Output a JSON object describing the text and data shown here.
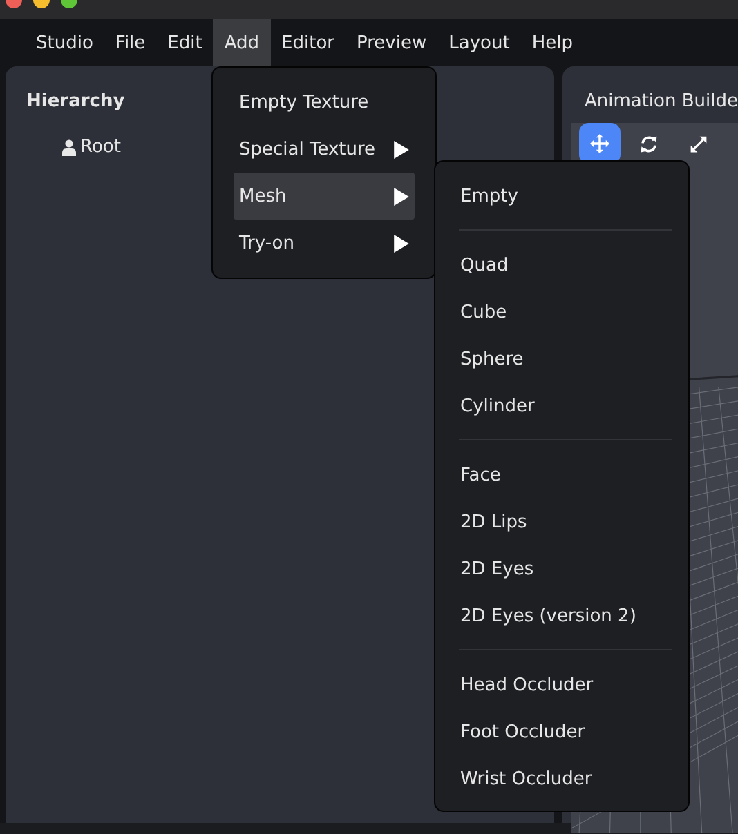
{
  "menubar": [
    {
      "label": "Studio",
      "selected": false
    },
    {
      "label": "File",
      "selected": false
    },
    {
      "label": "Edit",
      "selected": false
    },
    {
      "label": "Add",
      "selected": true
    },
    {
      "label": "Editor",
      "selected": false
    },
    {
      "label": "Preview",
      "selected": false
    },
    {
      "label": "Layout",
      "selected": false
    },
    {
      "label": "Help",
      "selected": false
    }
  ],
  "hierarchy": {
    "title": "Hierarchy",
    "items": [
      {
        "label": "Root"
      }
    ]
  },
  "animation_builder": {
    "title": "Animation Builde",
    "tools": [
      {
        "kind": "move",
        "selected": true
      },
      {
        "kind": "rotate",
        "selected": false
      },
      {
        "kind": "scale",
        "selected": false
      }
    ]
  },
  "add_menu": {
    "items": [
      {
        "label": "Empty Texture",
        "submenu": false,
        "selected": false
      },
      {
        "label": "Special Texture",
        "submenu": true,
        "selected": false
      },
      {
        "label": "Mesh",
        "submenu": true,
        "selected": true
      },
      {
        "label": "Try-on",
        "submenu": true,
        "selected": false
      }
    ]
  },
  "mesh_submenu": {
    "groups": [
      [
        "Empty"
      ],
      [
        "Quad",
        "Cube",
        "Sphere",
        "Cylinder"
      ],
      [
        "Face",
        "2D Lips",
        "2D Eyes",
        "2D Eyes (version 2)"
      ],
      [
        "Head Occluder",
        "Foot Occluder",
        "Wrist Occluder"
      ]
    ]
  }
}
